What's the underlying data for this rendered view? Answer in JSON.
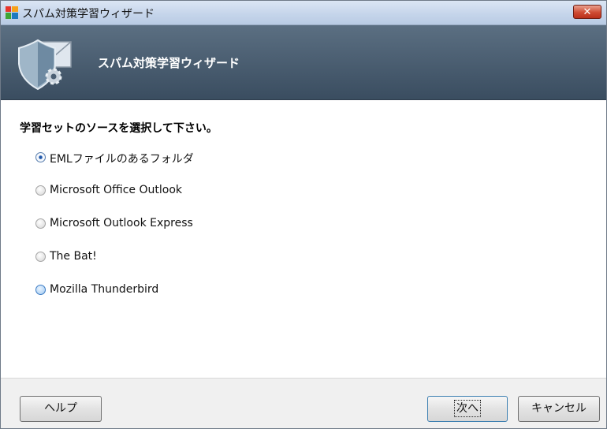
{
  "window": {
    "title": "スパム対策学習ウィザード",
    "close_label": "✕"
  },
  "banner": {
    "title": "スパム対策学習ウィザード"
  },
  "question": "学習セットのソースを選択して下さい。",
  "options": [
    {
      "label": "EMLファイルのあるフォルダ",
      "selected": true
    },
    {
      "label": "Microsoft Office Outlook",
      "selected": false
    },
    {
      "label": "Microsoft Outlook Express",
      "selected": false
    },
    {
      "label": "The Bat!",
      "selected": false
    },
    {
      "label": "Mozilla Thunderbird",
      "selected": false
    }
  ],
  "buttons": {
    "help": "ヘルプ",
    "next": "次へ",
    "cancel": "キャンセル"
  },
  "colors": {
    "banner": "#4a5e72",
    "accent": "#2c64b8",
    "close": "#cf4b33"
  }
}
